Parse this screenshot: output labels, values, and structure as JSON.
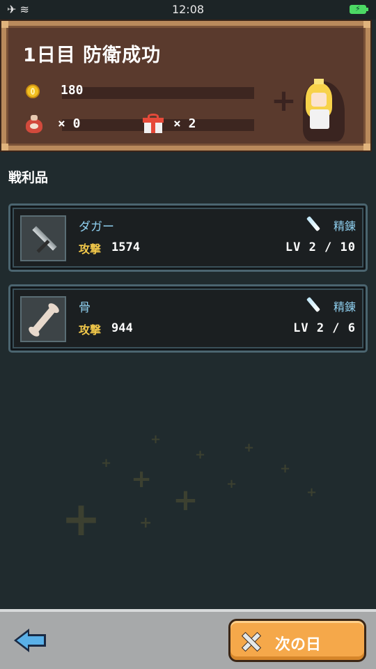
{
  "status_bar": {
    "time": "12:08",
    "left_icons": "✈ ≋"
  },
  "header": {
    "title": "1日目 防衛成功",
    "gold": "180",
    "bag_count": "× 0",
    "gift_count": "× 2"
  },
  "loot_section": {
    "title": "戦利品"
  },
  "items": [
    {
      "name": "ダガー",
      "attack_label": "攻撃",
      "attack": "1574",
      "refine_label": "精錬",
      "level": "LV 2 / 10",
      "icon": "dagger-icon"
    },
    {
      "name": "骨",
      "attack_label": "攻撃",
      "attack": "944",
      "refine_label": "精錬",
      "level": "LV 2 / 6",
      "icon": "bone-icon"
    }
  ],
  "bottom_bar": {
    "next_day_label": "次の日"
  },
  "colors": {
    "panel_brown": "#5a3a2d",
    "panel_border": "#b98a5c",
    "card_border": "#4b6570",
    "accent_blue": "#8fd0f0",
    "accent_yellow": "#f2c84a",
    "button_orange": "#f5a84a"
  }
}
